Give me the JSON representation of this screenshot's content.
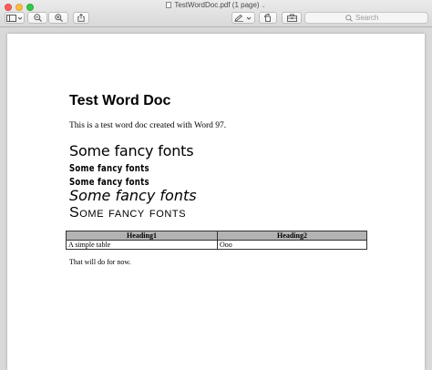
{
  "window": {
    "title": "TestWordDoc.pdf (1 page)"
  },
  "toolbar": {
    "buttons": [
      {
        "name": "sidebar-toggle",
        "icon": "sidebar-icon"
      },
      {
        "name": "zoom-out",
        "icon": "zoom-out-icon"
      },
      {
        "name": "zoom-in",
        "icon": "zoom-in-icon"
      },
      {
        "name": "share",
        "icon": "share-icon"
      },
      {
        "name": "markup",
        "icon": "pen-icon"
      },
      {
        "name": "rotate",
        "icon": "rotate-icon"
      },
      {
        "name": "toolbox",
        "icon": "toolbox-icon"
      }
    ],
    "search_placeholder": "Search"
  },
  "document": {
    "title": "Test Word Doc",
    "intro": "This is a test word doc created with Word 97.",
    "fancy_fonts": [
      "Some fancy fonts",
      "Some fancy fonts",
      "Some fancy fonts",
      "Some fancy fonts",
      "Some fancy fonts"
    ],
    "table": {
      "headers": [
        "Heading1",
        "Heading2"
      ],
      "rows": [
        [
          "A simple table",
          "Ooo"
        ]
      ]
    },
    "footer": "That will do for now."
  }
}
